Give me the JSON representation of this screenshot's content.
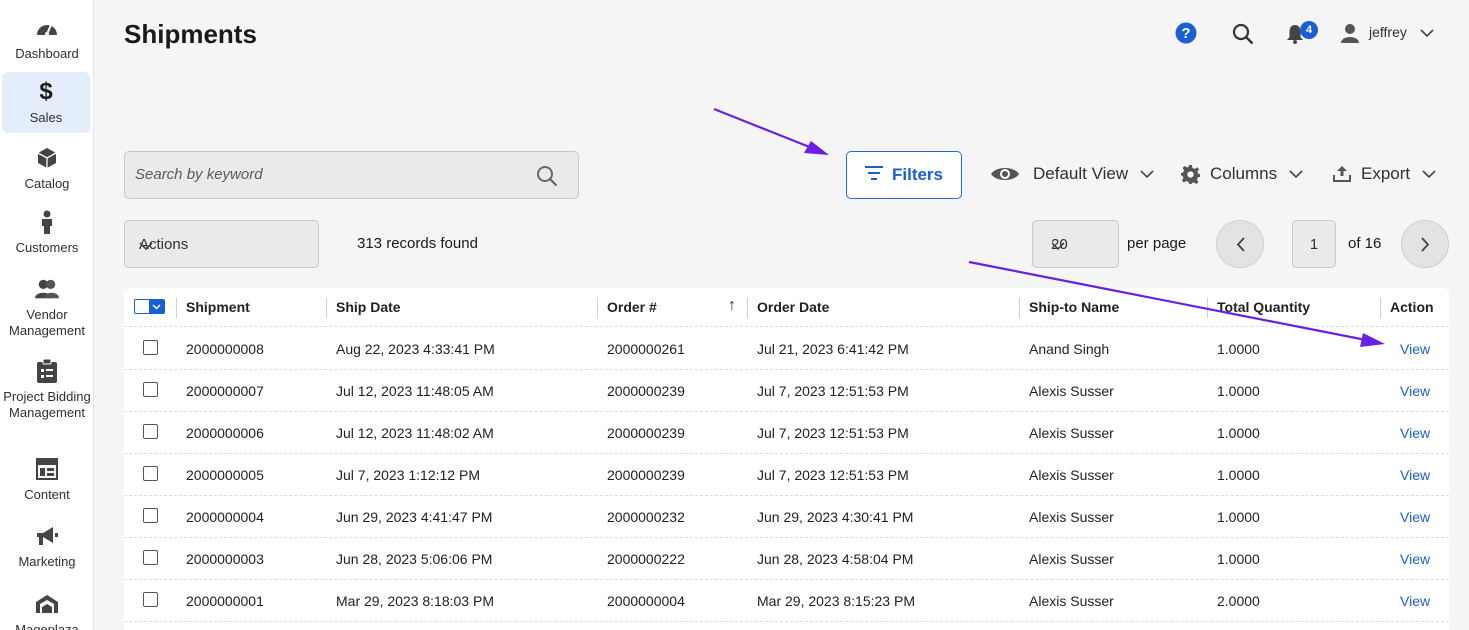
{
  "sidebar": {
    "items": [
      {
        "label": "Dashboard",
        "icon": "dashboard-icon"
      },
      {
        "label": "Sales",
        "icon": "dollar-icon",
        "active": true
      },
      {
        "label": "Catalog",
        "icon": "cube-icon"
      },
      {
        "label": "Customers",
        "icon": "person-icon"
      },
      {
        "label": "Vendor Management",
        "icon": "vendors-icon"
      },
      {
        "label": "Project Bidding Management",
        "icon": "clipboard-icon"
      },
      {
        "label": "Content",
        "icon": "layout-icon"
      },
      {
        "label": "Marketing",
        "icon": "megaphone-icon"
      },
      {
        "label": "Mageplaza",
        "icon": "mageplaza-icon"
      }
    ]
  },
  "header": {
    "title": "Shipments",
    "notifications_count": "4",
    "username": "jeffrey"
  },
  "toolbar": {
    "search_placeholder": "Search by keyword",
    "filters_label": "Filters",
    "view_label": "Default View",
    "columns_label": "Columns",
    "export_label": "Export"
  },
  "actions_bar": {
    "actions_label": "Actions",
    "records_text": "313 records found",
    "per_page_value": "20",
    "per_page_label": "per page",
    "current_page": "1",
    "page_total_text": "of 16"
  },
  "table": {
    "columns": [
      "Shipment",
      "Ship Date",
      "Order #",
      "Order Date",
      "Ship-to Name",
      "Total Quantity",
      "Action"
    ],
    "sort_indicator": "↑",
    "rows": [
      {
        "shipment": "2000000008",
        "ship_date": "Aug 22, 2023 4:33:41 PM",
        "order": "2000000261",
        "order_date": "Jul 21, 2023 6:41:42 PM",
        "name": "Anand Singh",
        "qty": "1.0000",
        "action": "View"
      },
      {
        "shipment": "2000000007",
        "ship_date": "Jul 12, 2023 11:48:05 AM",
        "order": "2000000239",
        "order_date": "Jul 7, 2023 12:51:53 PM",
        "name": "Alexis Susser",
        "qty": "1.0000",
        "action": "View"
      },
      {
        "shipment": "2000000006",
        "ship_date": "Jul 12, 2023 11:48:02 AM",
        "order": "2000000239",
        "order_date": "Jul 7, 2023 12:51:53 PM",
        "name": "Alexis Susser",
        "qty": "1.0000",
        "action": "View"
      },
      {
        "shipment": "2000000005",
        "ship_date": "Jul 7, 2023 1:12:12 PM",
        "order": "2000000239",
        "order_date": "Jul 7, 2023 12:51:53 PM",
        "name": "Alexis Susser",
        "qty": "1.0000",
        "action": "View"
      },
      {
        "shipment": "2000000004",
        "ship_date": "Jun 29, 2023 4:41:47 PM",
        "order": "2000000232",
        "order_date": "Jun 29, 2023 4:30:41 PM",
        "name": "Alexis Susser",
        "qty": "1.0000",
        "action": "View"
      },
      {
        "shipment": "2000000003",
        "ship_date": "Jun 28, 2023 5:06:06 PM",
        "order": "2000000222",
        "order_date": "Jun 28, 2023 4:58:04 PM",
        "name": "Alexis Susser",
        "qty": "1.0000",
        "action": "View"
      },
      {
        "shipment": "2000000001",
        "ship_date": "Mar 29, 2023 8:18:03 PM",
        "order": "2000000004",
        "order_date": "Mar 29, 2023 8:15:23 PM",
        "name": "Alexis Susser",
        "qty": "2.0000",
        "action": "View"
      }
    ]
  },
  "colors": {
    "accent": "#1a5fd6",
    "annotation_arrow": "#6a1ee6",
    "active_nav_bg": "#e4eefb"
  }
}
